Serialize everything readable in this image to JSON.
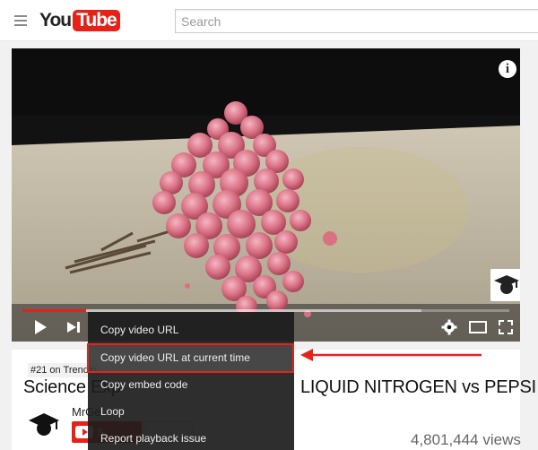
{
  "masthead": {
    "menu_icon": "hamburger-icon",
    "logo_you": "You",
    "logo_tube": "Tube",
    "search_placeholder": "Search"
  },
  "player": {
    "info_icon_glyph": "i",
    "progress_fraction": 0.13,
    "loaded_fraction": 0.82,
    "controls": [
      "play-icon",
      "next-icon",
      "volume-icon",
      "gear-icon",
      "theater-icon",
      "fullscreen-icon"
    ]
  },
  "context_menu": {
    "items": [
      {
        "label": "Copy video URL"
      },
      {
        "label": "Copy video URL at current time"
      },
      {
        "label": "Copy embed code"
      },
      {
        "label": "Loop"
      },
      {
        "label": "Report playback issue"
      }
    ],
    "highlighted_index": 1
  },
  "video": {
    "trending": "#21 on Trendin",
    "title_left": "Science Exp",
    "title_right": "LIQUID NITROGEN vs PEPSI",
    "channel_name": "MrGe",
    "subscribe_label": "S",
    "views": "4,801,444 views"
  },
  "colors": {
    "brand_red": "#e62117",
    "annotation_red": "#e5231b"
  }
}
